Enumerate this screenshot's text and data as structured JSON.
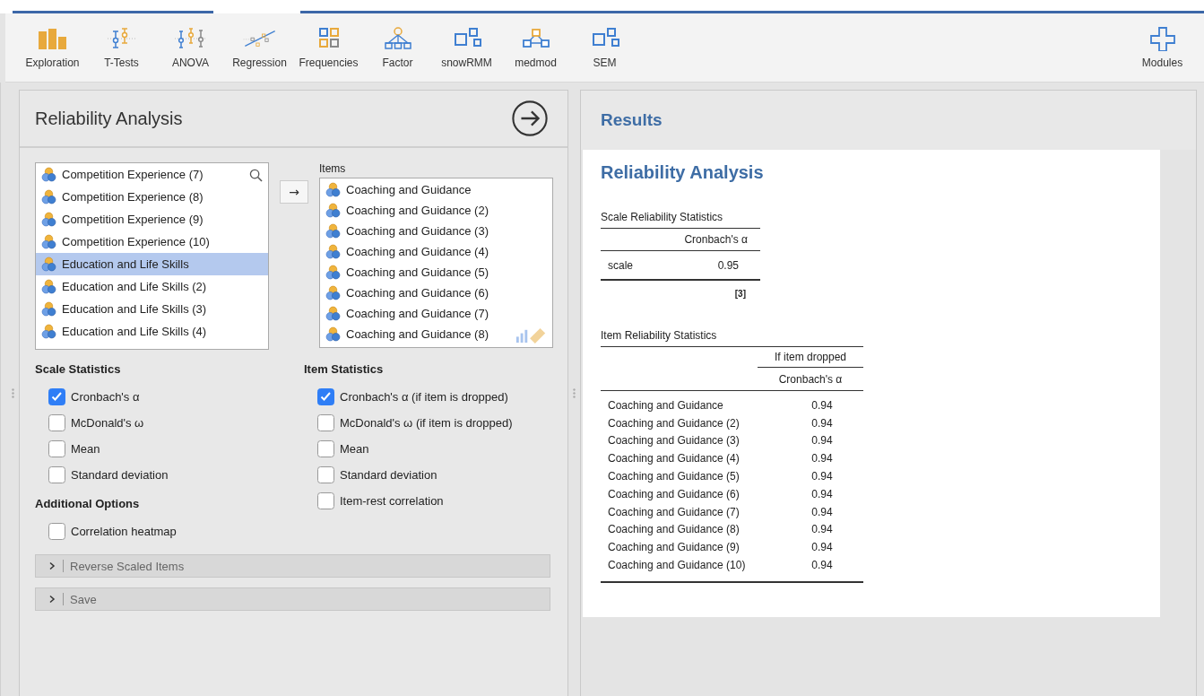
{
  "toolbar": {
    "analyses": [
      {
        "label": "Exploration"
      },
      {
        "label": "T-Tests"
      },
      {
        "label": "ANOVA"
      },
      {
        "label": "Regression"
      },
      {
        "label": "Frequencies"
      },
      {
        "label": "Factor"
      },
      {
        "label": "snowRMM"
      },
      {
        "label": "medmod"
      },
      {
        "label": "SEM"
      }
    ],
    "modules": {
      "label": "Modules"
    }
  },
  "options_panel": {
    "title": "Reliability Analysis",
    "variables": [
      {
        "name": "Competition Experience (7)",
        "selected": false
      },
      {
        "name": "Competition Experience (8)",
        "selected": false
      },
      {
        "name": "Competition Experience (9)",
        "selected": false
      },
      {
        "name": "Competition Experience (10)",
        "selected": false
      },
      {
        "name": "Education and Life Skills",
        "selected": true
      },
      {
        "name": "Education and Life Skills (2)",
        "selected": false
      },
      {
        "name": "Education and Life Skills (3)",
        "selected": false
      },
      {
        "name": "Education and Life Skills (4)",
        "selected": false
      }
    ],
    "move_button": "→",
    "items_label": "Items",
    "items": [
      {
        "name": "Coaching and Guidance",
        "selected": false
      },
      {
        "name": "Coaching and Guidance (2)",
        "selected": false
      },
      {
        "name": "Coaching and Guidance (3)",
        "selected": false
      },
      {
        "name": "Coaching and Guidance (4)",
        "selected": false
      },
      {
        "name": "Coaching and Guidance (5)",
        "selected": false
      },
      {
        "name": "Coaching and Guidance (6)",
        "selected": false
      },
      {
        "name": "Coaching and Guidance (7)",
        "selected": false
      },
      {
        "name": "Coaching and Guidance (8)",
        "selected": false
      }
    ],
    "scale_statistics": {
      "heading": "Scale Statistics",
      "options": [
        {
          "label": "Cronbach's α",
          "checked": true
        },
        {
          "label": "McDonald's ω",
          "checked": false
        },
        {
          "label": "Mean",
          "checked": false
        },
        {
          "label": "Standard deviation",
          "checked": false
        }
      ]
    },
    "item_statistics": {
      "heading": "Item Statistics",
      "options": [
        {
          "label": "Cronbach's α (if item is dropped)",
          "checked": true
        },
        {
          "label": "McDonald's ω (if item is dropped)",
          "checked": false
        },
        {
          "label": "Mean",
          "checked": false
        },
        {
          "label": "Standard deviation",
          "checked": false
        },
        {
          "label": "Item-rest correlation",
          "checked": false
        }
      ]
    },
    "additional_options": {
      "heading": "Additional Options",
      "options": [
        {
          "label": "Correlation heatmap",
          "checked": false
        }
      ]
    },
    "sections": [
      {
        "label": "Reverse Scaled Items",
        "expanded": false
      },
      {
        "label": "Save",
        "expanded": false
      }
    ]
  },
  "results": {
    "title": "Results",
    "analysis_title": "Reliability Analysis",
    "scale_table": {
      "caption": "Scale Reliability Statistics",
      "columns": [
        "Cronbach's α"
      ],
      "rows": [
        {
          "label": "scale",
          "value": "0.95"
        }
      ],
      "footnote": "[3]"
    },
    "item_table": {
      "caption": "Item Reliability Statistics",
      "group_header": "If item dropped",
      "columns": [
        "Cronbach's α"
      ],
      "rows": [
        {
          "label": "Coaching and Guidance",
          "value": "0.94"
        },
        {
          "label": "Coaching and Guidance (2)",
          "value": "0.94"
        },
        {
          "label": "Coaching and Guidance (3)",
          "value": "0.94"
        },
        {
          "label": "Coaching and Guidance (4)",
          "value": "0.94"
        },
        {
          "label": "Coaching and Guidance (5)",
          "value": "0.94"
        },
        {
          "label": "Coaching and Guidance (6)",
          "value": "0.94"
        },
        {
          "label": "Coaching and Guidance (7)",
          "value": "0.94"
        },
        {
          "label": "Coaching and Guidance (8)",
          "value": "0.94"
        },
        {
          "label": "Coaching and Guidance (9)",
          "value": "0.94"
        },
        {
          "label": "Coaching and Guidance (10)",
          "value": "0.94"
        }
      ]
    }
  }
}
